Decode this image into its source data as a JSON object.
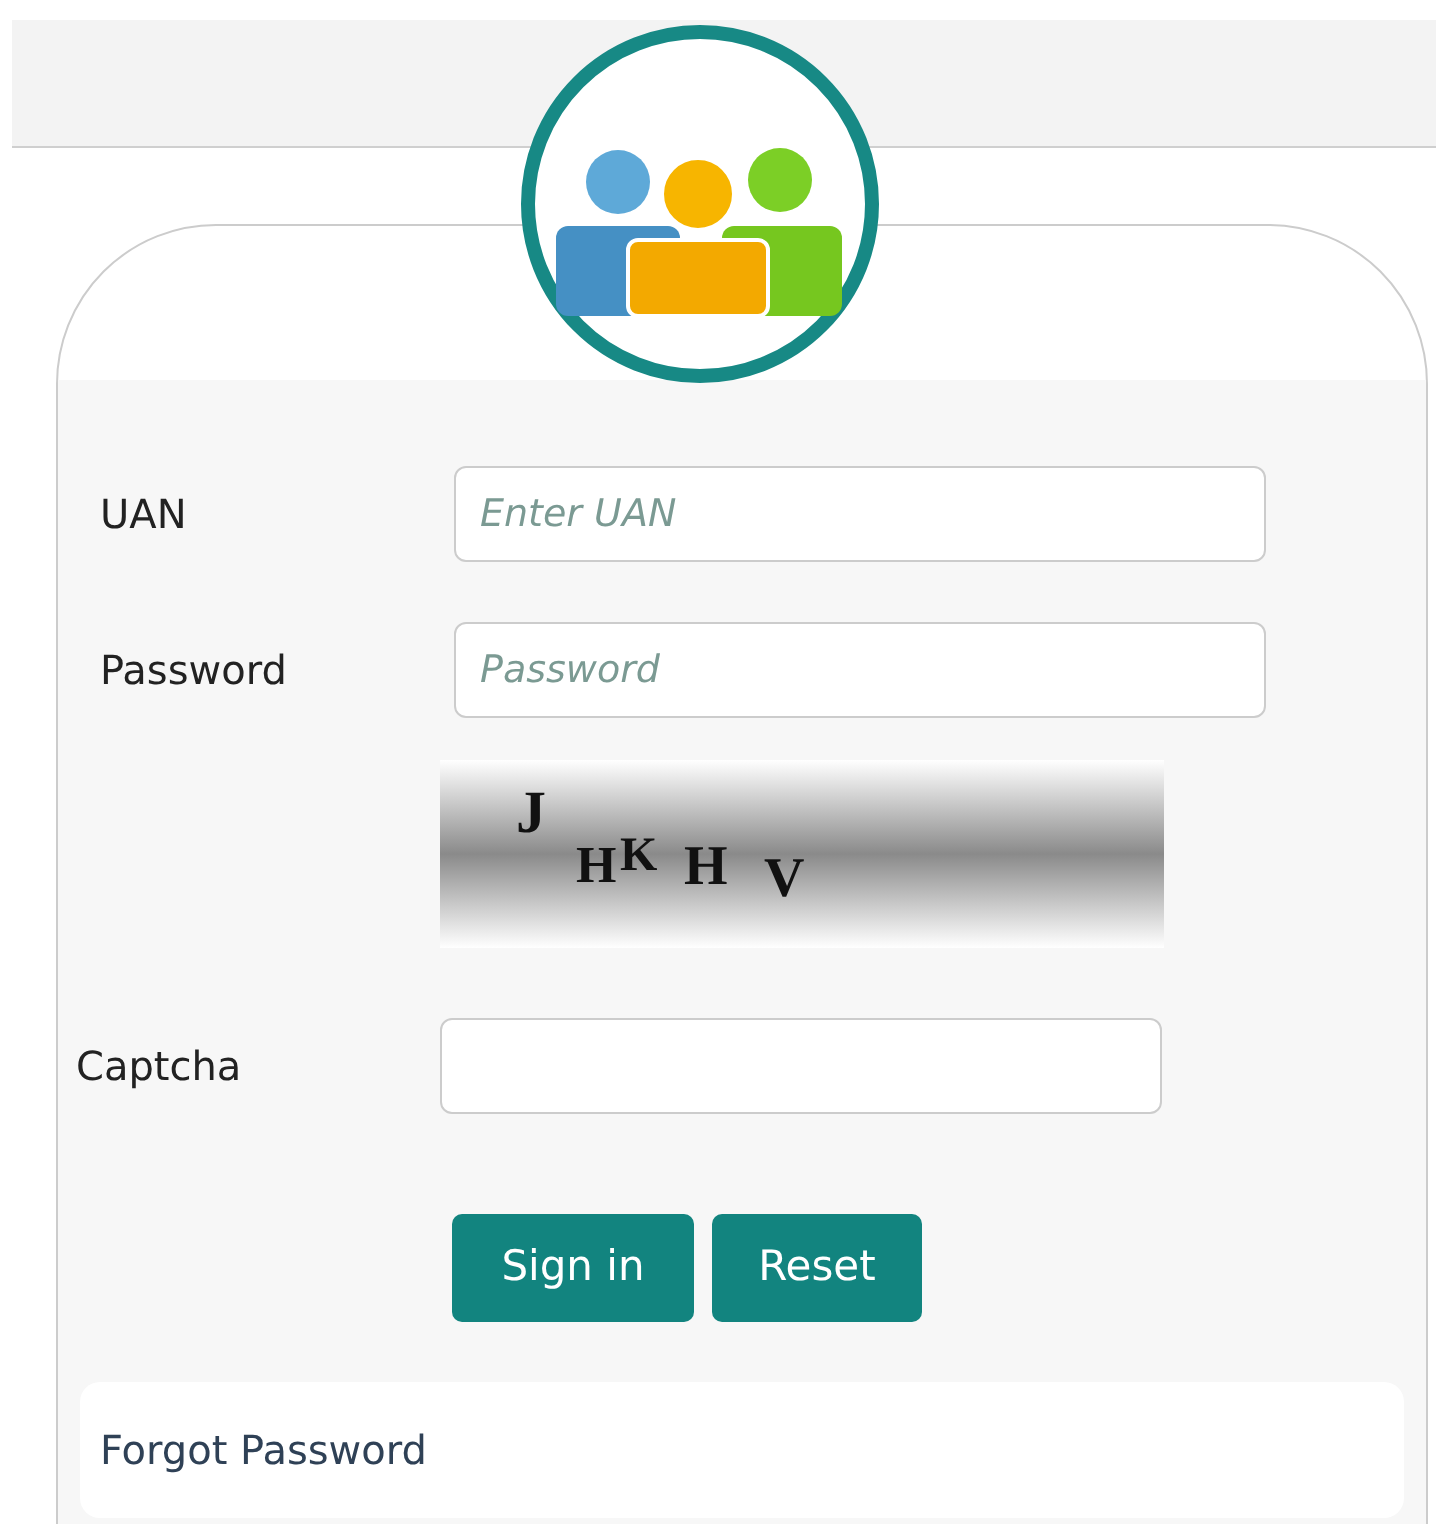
{
  "fields": [
    {
      "label": "UAN",
      "placeholder": "Enter UAN"
    },
    {
      "label": "Password",
      "placeholder": "Password"
    }
  ],
  "captcha": {
    "characters": [
      "J",
      "H",
      "K",
      "H",
      "V"
    ],
    "label": "Captcha"
  },
  "buttons": [
    "Sign in",
    "Reset"
  ],
  "forgot_link": "Forgot Password"
}
